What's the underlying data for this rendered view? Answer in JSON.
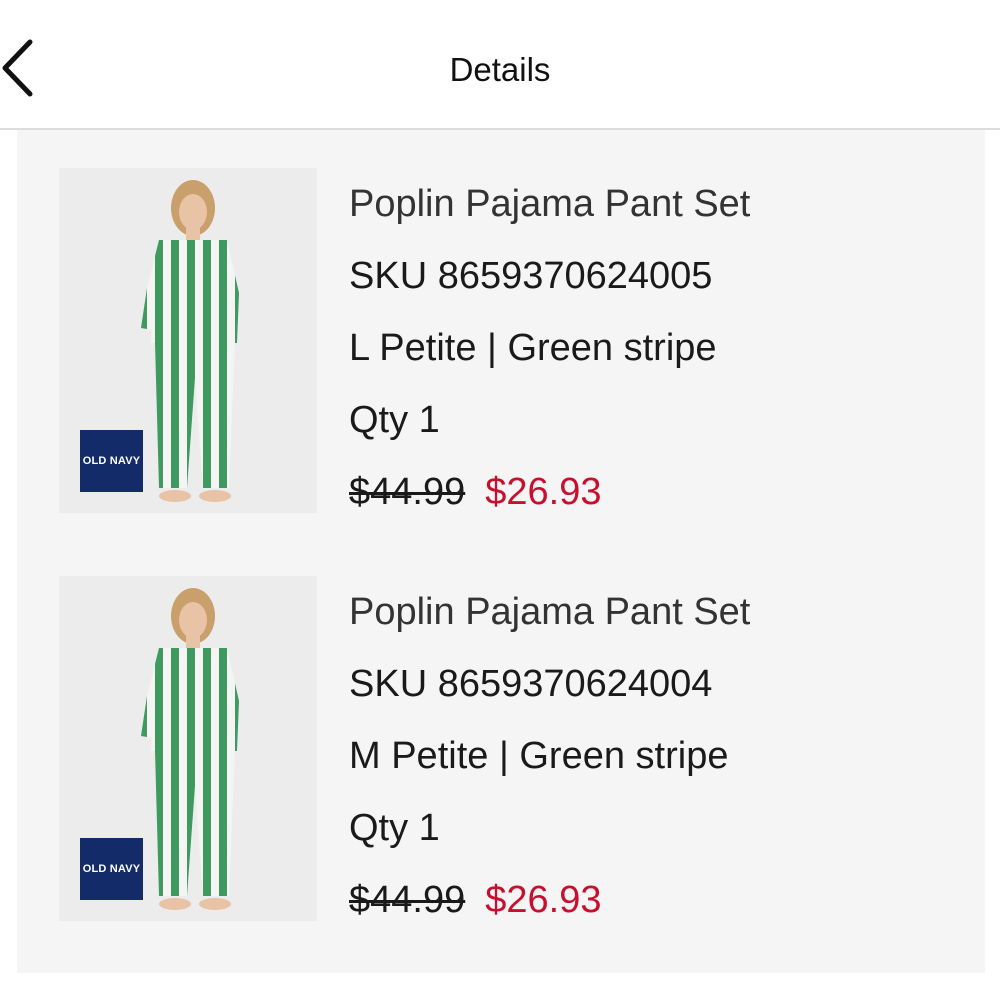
{
  "header": {
    "title": "Details",
    "back_icon": "chevron-left-icon"
  },
  "items": [
    {
      "name": "Poplin Pajama Pant Set",
      "sku": "SKU 8659370624005",
      "variant": "L  Petite | Green stripe",
      "qty": "Qty 1",
      "original_price": "$44.99",
      "sale_price": "$26.93",
      "brand_logo": "OLD NAVY"
    },
    {
      "name": "Poplin Pajama Pant Set",
      "sku": "SKU 8659370624004",
      "variant": "M  Petite | Green stripe",
      "qty": "Qty 1",
      "original_price": "$44.99",
      "sale_price": "$26.93",
      "brand_logo": "OLD NAVY"
    }
  ],
  "colors": {
    "sale_price": "#c8102e",
    "brand_logo_bg": "#132c69",
    "stripe_green": "#3e9a5e",
    "panel_bg": "#f5f5f5"
  }
}
